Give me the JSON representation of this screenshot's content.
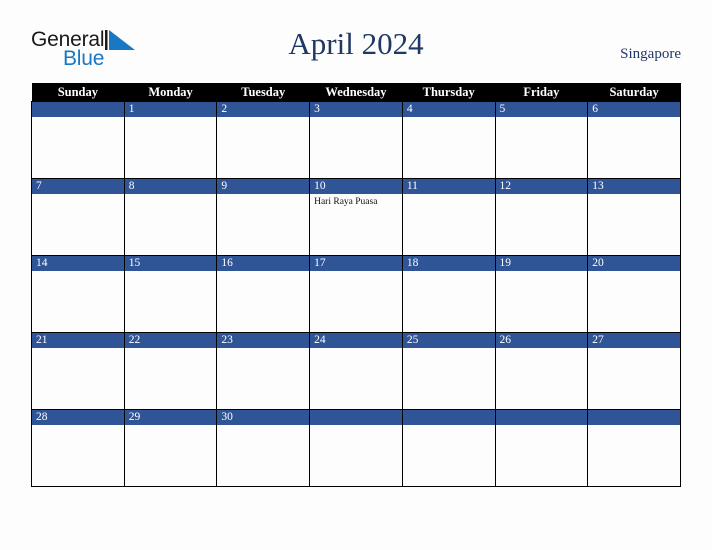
{
  "brand": {
    "name_part1": "General",
    "name_part2": "Blue",
    "triangle_color": "#1878c4",
    "text_color": "#1a1a1a"
  },
  "header": {
    "title": "April 2024",
    "country": "Singapore",
    "title_color": "#1f3864"
  },
  "calendar": {
    "weekday_headers": [
      "Sunday",
      "Monday",
      "Tuesday",
      "Wednesday",
      "Thursday",
      "Friday",
      "Saturday"
    ],
    "header_bg": "#000000",
    "date_band_color": "#2f5597",
    "weeks": [
      [
        {
          "date": "",
          "events": []
        },
        {
          "date": "1",
          "events": []
        },
        {
          "date": "2",
          "events": []
        },
        {
          "date": "3",
          "events": []
        },
        {
          "date": "4",
          "events": []
        },
        {
          "date": "5",
          "events": []
        },
        {
          "date": "6",
          "events": []
        }
      ],
      [
        {
          "date": "7",
          "events": []
        },
        {
          "date": "8",
          "events": []
        },
        {
          "date": "9",
          "events": []
        },
        {
          "date": "10",
          "events": [
            "Hari Raya Puasa"
          ]
        },
        {
          "date": "11",
          "events": []
        },
        {
          "date": "12",
          "events": []
        },
        {
          "date": "13",
          "events": []
        }
      ],
      [
        {
          "date": "14",
          "events": []
        },
        {
          "date": "15",
          "events": []
        },
        {
          "date": "16",
          "events": []
        },
        {
          "date": "17",
          "events": []
        },
        {
          "date": "18",
          "events": []
        },
        {
          "date": "19",
          "events": []
        },
        {
          "date": "20",
          "events": []
        }
      ],
      [
        {
          "date": "21",
          "events": []
        },
        {
          "date": "22",
          "events": []
        },
        {
          "date": "23",
          "events": []
        },
        {
          "date": "24",
          "events": []
        },
        {
          "date": "25",
          "events": []
        },
        {
          "date": "26",
          "events": []
        },
        {
          "date": "27",
          "events": []
        }
      ],
      [
        {
          "date": "28",
          "events": []
        },
        {
          "date": "29",
          "events": []
        },
        {
          "date": "30",
          "events": []
        },
        {
          "date": "",
          "events": []
        },
        {
          "date": "",
          "events": []
        },
        {
          "date": "",
          "events": []
        },
        {
          "date": "",
          "events": []
        }
      ]
    ]
  }
}
